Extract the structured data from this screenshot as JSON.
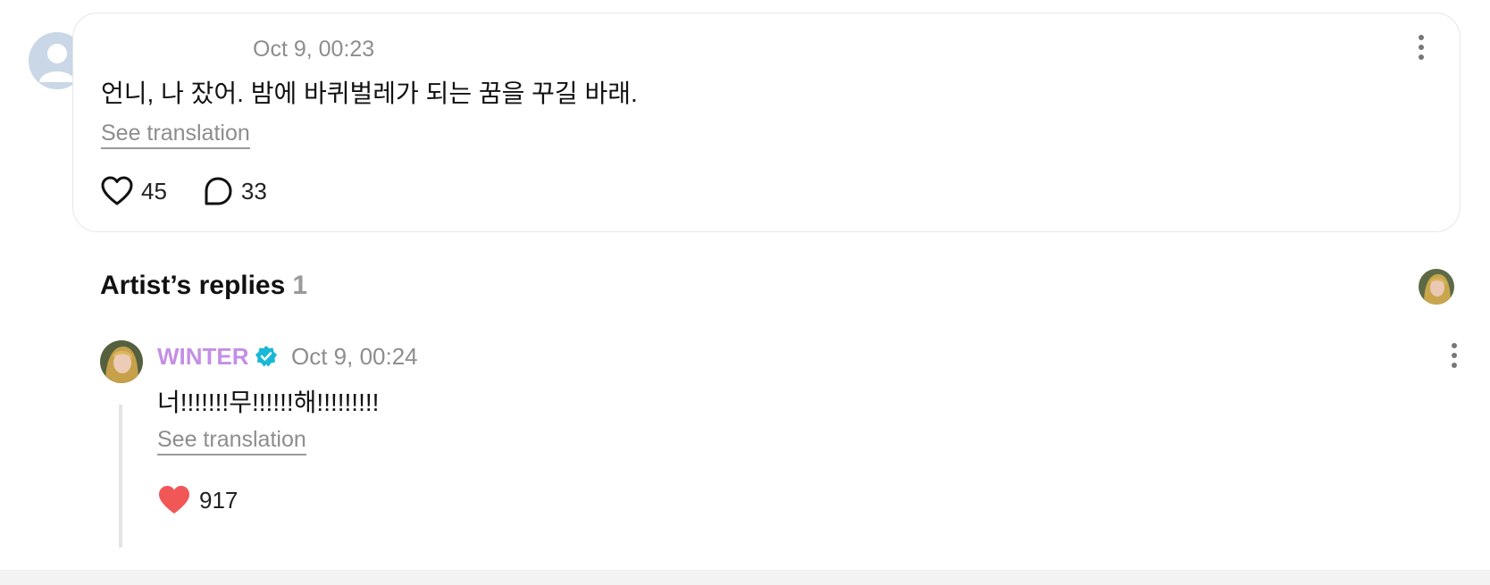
{
  "comment": {
    "timestamp": "Oct 9, 00:23",
    "text": "언니, 나 잤어. 밤에 바퀴벌레가 되는 꿈을 꾸길 바래.",
    "see_translation": "See translation",
    "likes": "45",
    "replies": "33",
    "icons": {
      "like": "heart-outline-icon",
      "reply": "speech-bubble-icon",
      "more": "more-vertical-icon",
      "avatar": "default-user-avatar"
    }
  },
  "artist_replies": {
    "title": "Artist’s replies",
    "count": "1"
  },
  "reply": {
    "author": "WINTER",
    "timestamp": "Oct 9, 00:24",
    "text": "너!!!!!!!무!!!!!!해!!!!!!!!!",
    "see_translation": "See translation",
    "likes": "917",
    "icons": {
      "verified": "verified-badge-icon",
      "like": "heart-filled-icon",
      "more": "more-vertical-icon"
    }
  },
  "colors": {
    "artist_name": "#c48fe6",
    "verified": "#19b8d6",
    "liked_heart": "#f25757",
    "muted_text": "#8d8d8d"
  }
}
